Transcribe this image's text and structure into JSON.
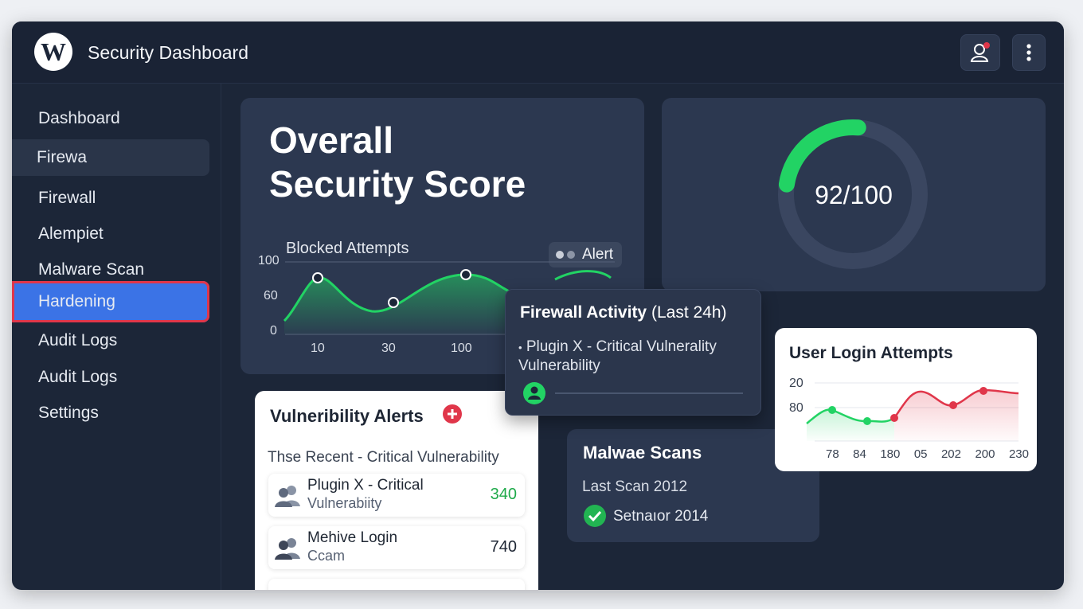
{
  "app": {
    "title": "Security Dashboard",
    "logo_icon": "wordpress-logo"
  },
  "topbar": {
    "user_icon": "user-alert-icon",
    "menu_icon": "more-vertical-icon"
  },
  "sidebar": {
    "items": [
      {
        "label": "Dashboard",
        "state": "normal"
      },
      {
        "label": "Firewa",
        "state": "selected"
      },
      {
        "label": "Firewall",
        "state": "normal"
      },
      {
        "label": "Alempiet",
        "state": "normal"
      },
      {
        "label": "Malware Scan",
        "state": "normal"
      },
      {
        "label": "Hardening",
        "state": "active"
      },
      {
        "label": "Audit Logs",
        "state": "normal"
      },
      {
        "label": "Audit Logs",
        "state": "normal"
      },
      {
        "label": "Settings",
        "state": "normal"
      }
    ]
  },
  "score_card": {
    "title_line1": "Overall",
    "title_line2": "Security Score",
    "chart_title": "Blocked Attempts",
    "alert_chip": "Alert",
    "y_ticks": [
      "100",
      "60",
      "0"
    ],
    "x_ticks": [
      "10",
      "30",
      "100"
    ]
  },
  "gauge": {
    "text": "92/100",
    "value": 92,
    "max": 100,
    "color": "#22d364"
  },
  "firewall_popup": {
    "title": "Firewall Activity",
    "title_suffix": "(Last 24h)",
    "line1": "Plugin X - Critical Vulnerality",
    "line2": "Vulnerability"
  },
  "login_card": {
    "title": "User Login Attempts",
    "y_ticks": [
      "20",
      "80"
    ],
    "x_ticks": [
      "78",
      "84",
      "180",
      "05",
      "202",
      "200",
      "230"
    ]
  },
  "vuln_card": {
    "title": "Vulneribility Alerts",
    "subtitle": "Thse Recent - Critical Vulnerability",
    "rows": [
      {
        "title": "Plugin X - Critical",
        "subtitle": "Vulnerabiity",
        "value": "340",
        "value_color": "#1faa4a"
      },
      {
        "title": "Mehive Login",
        "subtitle": "Ccam",
        "value": "740",
        "value_color": "#1e2634"
      }
    ]
  },
  "malware_card": {
    "title": "Malwae Scans",
    "last_scan": "Last Scan 2012",
    "status": "Setnaıor 2014"
  },
  "colors": {
    "background": "#1c2638",
    "card": "#2c3850",
    "accent_blue": "#3b73e6",
    "success_green": "#22d364",
    "danger_red": "#e0364a"
  }
}
